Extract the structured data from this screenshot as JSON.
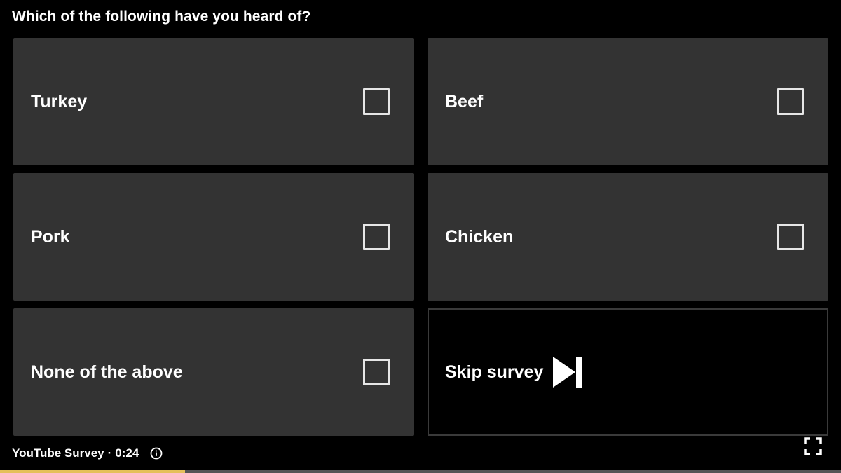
{
  "survey": {
    "question": "Which of the following have you heard of?",
    "options": [
      {
        "label": "Turkey",
        "checked": false
      },
      {
        "label": "Beef",
        "checked": false
      },
      {
        "label": "Pork",
        "checked": false
      },
      {
        "label": "Chicken",
        "checked": false
      },
      {
        "label": "None of the above",
        "checked": false
      }
    ],
    "skip_label": "Skip survey"
  },
  "footer": {
    "source": "YouTube Survey",
    "separator": "·",
    "time": "0:24"
  },
  "progress": {
    "fraction": 0.22
  },
  "colors": {
    "background": "#000000",
    "option_bg": "#333333",
    "progress_fill": "#e5c05a",
    "progress_track": "#555555"
  },
  "icons": {
    "checkbox": "checkbox-empty-icon",
    "skip": "skip-next-icon",
    "info": "info-icon",
    "fullscreen": "fullscreen-icon"
  }
}
